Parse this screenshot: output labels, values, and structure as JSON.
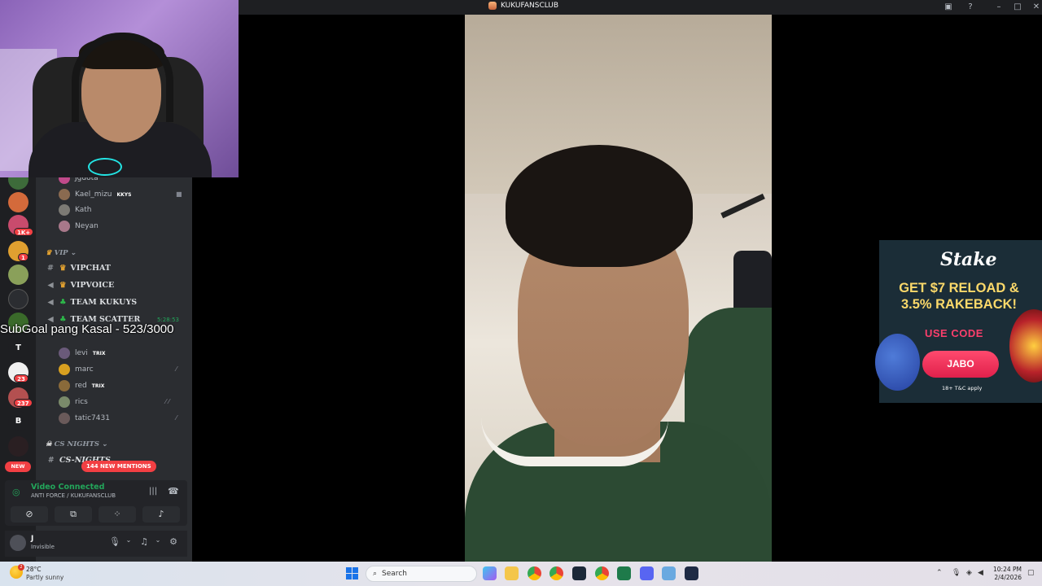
{
  "window": {
    "title": "KUKUFANSCLUB"
  },
  "sidebar": {
    "users_top": [
      {
        "name": "Jguota",
        "tag": ""
      },
      {
        "name": "Kael_mizu",
        "tag": "KKYS"
      },
      {
        "name": "Kath",
        "tag": ""
      },
      {
        "name": "Neyan",
        "tag": ""
      }
    ],
    "category_vip": "VIP",
    "channels": [
      {
        "name": "VIPCHAT",
        "type": "text"
      },
      {
        "name": "VIPVOICE",
        "type": "voice"
      },
      {
        "name": "TEAM KUKUYS",
        "type": "voice"
      },
      {
        "name": "TEAM SCATTER",
        "type": "voice",
        "time": "5:28:53"
      }
    ],
    "users_scatter": [
      {
        "name": "levi",
        "tag": "TRIX"
      },
      {
        "name": "marc",
        "tag": ""
      },
      {
        "name": "red",
        "tag": "TRIX"
      },
      {
        "name": "rics",
        "tag": ""
      },
      {
        "name": "tatic7431",
        "tag": ""
      }
    ],
    "category_cs": "CS NIGHTS",
    "cs_channel": "CS-NIGHTS",
    "new_label": "NEW",
    "mentions_label": "144 NEW MENTIONS",
    "server_letters": [
      "T",
      "B"
    ],
    "server_badges": [
      "1K+",
      "1",
      "23",
      "237"
    ]
  },
  "overlay": {
    "subgoal": "SubGoal pang Kasal - 523/3000"
  },
  "voice": {
    "status": "Video Connected",
    "channel": "ANTI FORCE / KUKUFANSCLUB"
  },
  "user": {
    "name": "J",
    "status": "Invisible"
  },
  "ad": {
    "brand": "Stake",
    "headline": "GET $7 RELOAD & 3.5% RAKEBACK!",
    "use_code": "USE CODE",
    "code": "JABO",
    "legal": "18+ T&C apply"
  },
  "taskbar": {
    "temp": "28°C",
    "weather": "Partly sunny",
    "weather_alert": "2",
    "search_placeholder": "Search",
    "time": "10:24 PM",
    "date": "2/4/2026"
  },
  "colors": {
    "discord_bg": "#2b2d31",
    "rail_bg": "#1e1f22",
    "connected_green": "#23a55a",
    "mention_red": "#f23f43",
    "ad_gold": "#fcd96a",
    "ad_pink": "#fb3f6c"
  }
}
